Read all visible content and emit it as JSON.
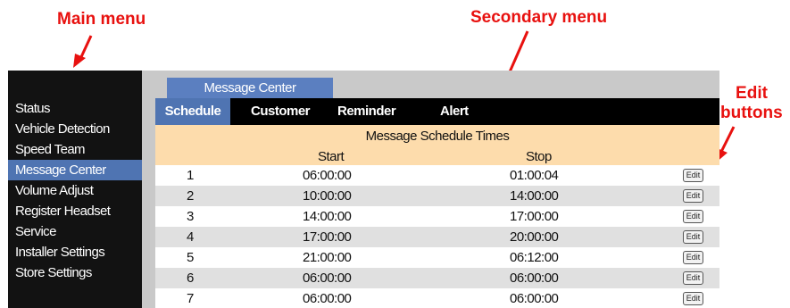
{
  "annotations": {
    "main_menu": "Main menu",
    "secondary_menu": "Secondary menu",
    "edit_buttons_line1": "Edit",
    "edit_buttons_line2": "buttons",
    "arrow_color": "#e8110f"
  },
  "main_menu": {
    "items": [
      {
        "label": "Status"
      },
      {
        "label": "Vehicle Detection"
      },
      {
        "label": "Speed Team"
      },
      {
        "label": "Message Center",
        "active": true
      },
      {
        "label": "Volume Adjust"
      },
      {
        "label": "Register Headset"
      },
      {
        "label": "Service"
      },
      {
        "label": "Installer Settings"
      },
      {
        "label": "Store Settings"
      }
    ]
  },
  "page_tab": "Message Center",
  "secondary_menu": {
    "tabs": [
      {
        "label": "Schedule",
        "active": true
      },
      {
        "label": "Customer"
      },
      {
        "label": "Reminder"
      },
      {
        "label": "Alert"
      }
    ]
  },
  "schedule": {
    "title": "Message Schedule Times",
    "columns": {
      "start": "Start",
      "stop": "Stop"
    },
    "edit_label": "Edit",
    "rows": [
      {
        "num": "1",
        "start": "06:00:00",
        "stop": "01:00:04"
      },
      {
        "num": "2",
        "start": "10:00:00",
        "stop": "14:00:00"
      },
      {
        "num": "3",
        "start": "14:00:00",
        "stop": "17:00:00"
      },
      {
        "num": "4",
        "start": "17:00:00",
        "stop": "20:00:00"
      },
      {
        "num": "5",
        "start": "21:00:00",
        "stop": "06:12:00"
      },
      {
        "num": "6",
        "start": "06:00:00",
        "stop": "06:00:00"
      },
      {
        "num": "7",
        "start": "06:00:00",
        "stop": "06:00:00"
      }
    ]
  },
  "colors": {
    "active_blue": "#4f74b2",
    "header_peach": "#fddcac",
    "menu_black": "#121212"
  }
}
